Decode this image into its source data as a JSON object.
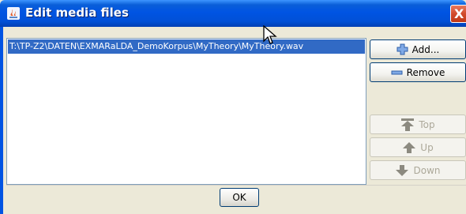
{
  "window": {
    "title": "Edit media files",
    "close_label": "X"
  },
  "media_list": {
    "items": [
      "T:\\TP-Z2\\DATEN\\EXMARaLDA_DemoKorpus\\MyTheory\\MyTheory.wav"
    ],
    "selected_index": 0
  },
  "side_buttons": {
    "add": "Add...",
    "remove": "Remove",
    "top": "Top",
    "up": "Up",
    "down": "Down"
  },
  "footer": {
    "ok": "OK"
  },
  "colors": {
    "title_bar": "#0054e3",
    "selection": "#316ac5",
    "close": "#d1492b",
    "window_bg": "#ece9d8"
  }
}
